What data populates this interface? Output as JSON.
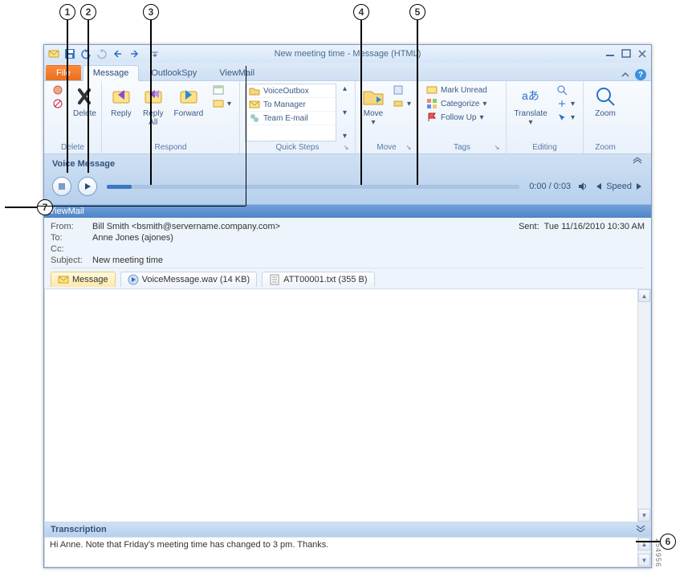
{
  "window": {
    "title_prefix": "New meeting time",
    "title_suffix": " -  Message (HTML)"
  },
  "tabs": {
    "file": "File",
    "message": "Message",
    "outlookspy": "OutlookSpy",
    "viewmail": "ViewMail"
  },
  "ribbon": {
    "delete": {
      "label": "Delete",
      "group": "Delete"
    },
    "respond": {
      "reply": "Reply",
      "reply_all": "Reply\nAll",
      "forward": "Forward",
      "group": "Respond"
    },
    "quicksteps": {
      "voiceoutbox": "VoiceOutbox",
      "to_manager": "To Manager",
      "team_email": "Team E-mail",
      "group": "Quick Steps"
    },
    "move": {
      "move": "Move",
      "group": "Move"
    },
    "tags": {
      "mark_unread": "Mark Unread",
      "categorize": "Categorize",
      "follow_up": "Follow Up",
      "group": "Tags"
    },
    "editing": {
      "translate": "Translate",
      "group": "Editing"
    },
    "zoom": {
      "zoom": "Zoom",
      "group": "Zoom"
    }
  },
  "voice_message": {
    "header": "Voice Message",
    "time": "0:00 / 0:03",
    "speed": "Speed"
  },
  "viewmail_header": "ViewMail",
  "headers": {
    "from_label": "From:",
    "from_value": "Bill Smith <bsmith@servername.company.com>",
    "sent_label": "Sent:",
    "sent_value": "Tue 11/16/2010 10:30 AM",
    "to_label": "To:",
    "to_value": "Anne Jones (ajones)",
    "cc_label": "Cc:",
    "cc_value": "",
    "subject_label": "Subject:",
    "subject_value": "New meeting time"
  },
  "attachments": {
    "message_tab": "Message",
    "voice_wav": "VoiceMessage.wav (14 KB)",
    "att_txt": "ATT00001.txt (355 B)"
  },
  "transcription": {
    "header": "Transcription",
    "body": "Hi Anne. Note that Friday's meeting time has changed to 3 pm. Thanks."
  },
  "image_id": "254956",
  "callouts": {
    "1": "1",
    "2": "2",
    "3": "3",
    "4": "4",
    "5": "5",
    "6": "6",
    "7": "7"
  }
}
